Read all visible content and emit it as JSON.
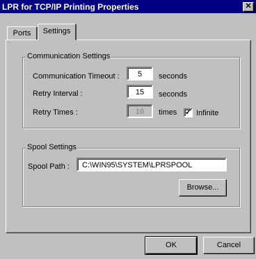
{
  "window": {
    "title": "LPR for TCP/IP Printing Properties",
    "close_glyph": "✕"
  },
  "tabs": [
    {
      "label": "Ports"
    },
    {
      "label": "Settings"
    }
  ],
  "communication": {
    "group_label": "Communication Settings",
    "timeout_label": "Communication Timeout :",
    "timeout_value": "5",
    "timeout_unit": "seconds",
    "retry_interval_label": "Retry Interval :",
    "retry_interval_value": "15",
    "retry_interval_unit": "seconds",
    "retry_times_label": "Retry Times :",
    "retry_times_value": "16",
    "retry_times_unit": "times",
    "infinite_label": "Infinite",
    "infinite_checked": true,
    "check_glyph": "✓"
  },
  "spool": {
    "group_label": "Spool Settings",
    "path_label": "Spool Path :",
    "path_value": "C:\\WIN95\\SYSTEM\\LPRSPOOL",
    "browse_label": "Browse..."
  },
  "footer": {
    "ok_label": "OK",
    "cancel_label": "Cancel"
  }
}
